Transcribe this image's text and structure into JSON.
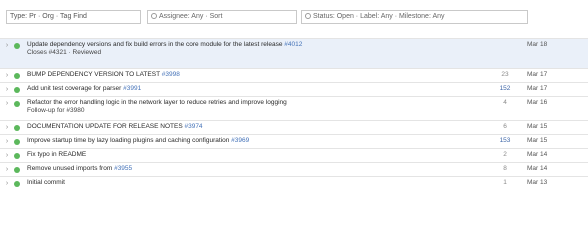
{
  "toolbar": {
    "search_value": "Type: Pr · Org · Tag  Find",
    "filter_value": "Assignee: Any · Sort",
    "status_value": "Status: Open · Label: Any · Milestone: Any"
  },
  "rows": [
    {
      "title": "Update dependency versions and fix build errors in the core module for the latest release",
      "subtitle": "Closes #4321 · Reviewed",
      "pr": "#4012",
      "count": "",
      "date": "Mar 18",
      "selected": true,
      "height": "h3"
    },
    {
      "title": "BUMP DEPENDENCY VERSION TO LATEST",
      "pr": "#3998",
      "count": "23",
      "date": "Mar 17",
      "selected": false,
      "height": "h1"
    },
    {
      "title": "Add unit test coverage for parser",
      "pr": "#3991",
      "count": "152",
      "date": "Mar 17",
      "selected": false,
      "height": "h1"
    },
    {
      "title": "Refactor the error handling logic in the network layer to reduce retries and improve logging",
      "subtitle": "Follow-up for #3980",
      "pr": "",
      "count": "4",
      "date": "Mar 16",
      "selected": false,
      "height": "h2"
    },
    {
      "title": "DOCUMENTATION UPDATE FOR RELEASE NOTES",
      "pr": "#3974",
      "count": "6",
      "date": "Mar 15",
      "selected": false,
      "height": "h1"
    },
    {
      "title": "Improve startup time by lazy loading plugins and caching configuration",
      "pr": "#3969",
      "count": "153",
      "date": "Mar 15",
      "selected": false,
      "height": "h1"
    },
    {
      "title": "Fix typo in README",
      "pr": "",
      "count": "2",
      "date": "Mar 14",
      "selected": false,
      "height": "h1"
    },
    {
      "title": "Remove unused imports from",
      "pr": "#3955",
      "count": "8",
      "date": "Mar 14",
      "selected": false,
      "height": "h1"
    },
    {
      "title": "Initial commit",
      "pr": "",
      "count": "1",
      "date": "Mar 13",
      "selected": false,
      "height": "h1"
    }
  ],
  "colors": {
    "status_dot": "#5cb85c",
    "selected_row": "#eaf0f9",
    "link": "#4472b8"
  },
  "icons": {
    "expand": "chevron-right-icon",
    "status": "open-status-dot-icon"
  }
}
